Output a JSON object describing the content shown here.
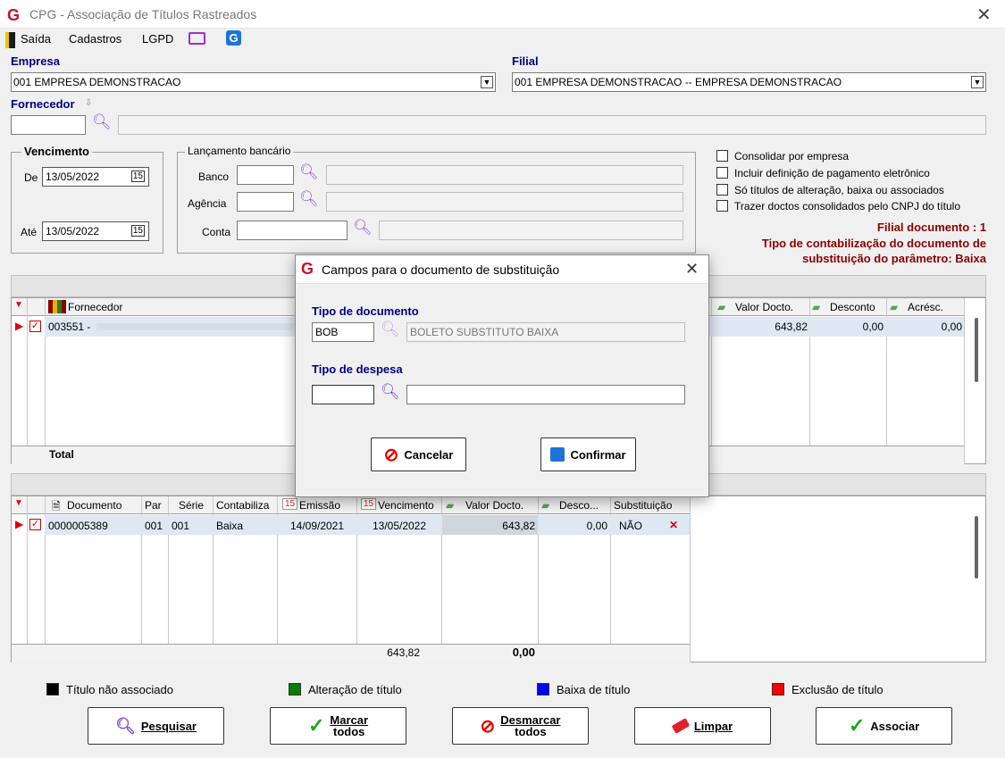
{
  "window": {
    "title": "CPG - Associação de Títulos Rastreados",
    "logo": "G",
    "close": "✕"
  },
  "menu": {
    "exit": "Saída",
    "registers": "Cadastros",
    "lgpd": "LGPD"
  },
  "empresa": {
    "label": "Empresa",
    "value": "001 EMPRESA DEMONSTRACAO"
  },
  "filial": {
    "label": "Filial",
    "value": "001 EMPRESA DEMONSTRACAO -- EMPRESA DEMONSTRACAO"
  },
  "fornecedor": {
    "label": "Fornecedor",
    "code": "",
    "name": ""
  },
  "vencimento": {
    "label": "Vencimento",
    "from_label": "De",
    "from": "13/05/2022",
    "to_label": "Até",
    "to": "13/05/2022"
  },
  "bank": {
    "label": "Lançamento bancário",
    "banco_label": "Banco",
    "agencia_label": "Agência",
    "conta_label": "Conta"
  },
  "options": [
    {
      "label": "Consolidar por empresa",
      "checked": false
    },
    {
      "label": "Incluir definição de pagamento eletrônico",
      "checked": false
    },
    {
      "label": "Só títulos de alteração, baixa ou associados",
      "checked": false
    },
    {
      "label": "Trazer doctos consolidados pelo CNPJ do título",
      "checked": false
    }
  ],
  "info": {
    "filial_doc": "Filial documento : 1",
    "tipo_line1": "Tipo de contabilização do documento de",
    "tipo_line2": "substituição do parâmetro: Baixa"
  },
  "grid1": {
    "headers": {
      "fornecedor": "Fornecedor",
      "valor": "Valor Docto.",
      "desconto": "Desconto",
      "acresc": "Acrésc."
    },
    "row": {
      "fornecedor": "003551 -",
      "valor": "643,82",
      "desconto": "0,00",
      "acresc": "0,00"
    },
    "total_label": "Total"
  },
  "grid2": {
    "headers": {
      "documento": "Documento",
      "par": "Par",
      "serie": "Série",
      "contabiliza": "Contabiliza",
      "emissao": "Emissão",
      "vencimento": "Vencimento",
      "valor": "Valor Docto.",
      "desconto": "Desco...",
      "substituicao": "Substituição"
    },
    "row": {
      "documento": "0000005389",
      "par": "001",
      "serie": "001",
      "contabiliza": "Baixa",
      "emissao": "14/09/2021",
      "vencimento": "13/05/2022",
      "valor": "643,82",
      "desconto": "0,00",
      "substituicao": "NÃO"
    },
    "totals": {
      "valor": "643,82",
      "desconto": "0,00"
    }
  },
  "legend": [
    {
      "label": "Título não associado",
      "color": "#000000"
    },
    {
      "label": "Alteração de título",
      "color": "#008000"
    },
    {
      "label": "Baixa de título",
      "color": "#0000ff"
    },
    {
      "label": "Exclusão de título",
      "color": "#ff0000"
    }
  ],
  "buttons": {
    "pesquisar": "Pesquisar",
    "marcar_1": "Marcar",
    "marcar_2": "todos",
    "desmarcar_1": "Desmarcar",
    "desmarcar_2": "todos",
    "limpar": "Limpar",
    "associar": "Associar"
  },
  "dialog": {
    "title": "Campos para o documento de substituição",
    "tipo_doc_label": "Tipo de documento",
    "tipo_doc_code": "BOB",
    "tipo_doc_name": "BOLETO SUBSTITUTO BAIXA",
    "tipo_desp_label": "Tipo de  despesa",
    "tipo_desp_code": "",
    "tipo_desp_name": "",
    "cancel": "Cancelar",
    "confirm": "Confirmar"
  }
}
